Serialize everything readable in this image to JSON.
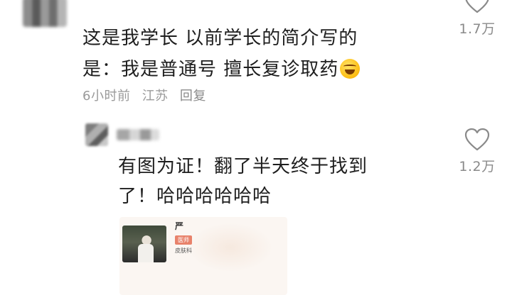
{
  "top_comment": {
    "text_line1": "这是我学长 以前学长的简介写的",
    "text_line2": "是：我是普通号 擅长复诊取药",
    "emoji": "rolling-on-floor-laughing-emoji",
    "time": "6小时前",
    "location": "江苏",
    "reply_label": "回复",
    "like_count": "1.7万"
  },
  "reply_comment": {
    "text_line1": "有图为证！翻了半天终于找到",
    "text_line2": "了！哈哈哈哈哈哈",
    "like_count": "1.2万",
    "image": {
      "glyph": "严",
      "badge": "医师",
      "department": "皮肤科"
    }
  },
  "colors": {
    "text": "#1e1e1e",
    "meta": "#9a9a9a",
    "heart_outline": "#8a8a8a",
    "badge": "#e8826b"
  }
}
